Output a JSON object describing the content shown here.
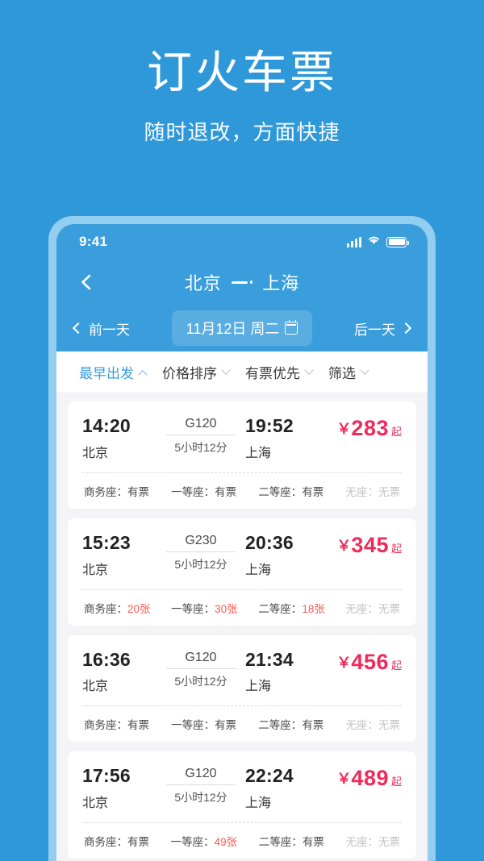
{
  "promo": {
    "title": "订火车票",
    "subtitle": "随时退改，方面快捷"
  },
  "colors": {
    "background_blue": "#2e98d8",
    "phone_frame": "#93cdef",
    "header_blue": "#3a9edc",
    "price_pink": "#ef2b5c",
    "count_red": "#fa5a52",
    "list_background": "#f4f4f6"
  },
  "status_bar": {
    "time": "9:41",
    "icons": [
      "signal-icon",
      "wifi-icon",
      "battery-icon"
    ]
  },
  "nav_header": {
    "back_icon": "chevron-left-icon",
    "origin": "北京",
    "destination": "上海",
    "arrow_icon": "one-way-arrow-icon"
  },
  "date_bar": {
    "prev_label": "前一天",
    "prev_icon": "chevron-left-icon",
    "date_label": "11月12日 周二",
    "calendar_icon": "calendar-icon",
    "next_label": "后一天",
    "next_icon": "chevron-right-icon"
  },
  "filter_bar": {
    "items": [
      {
        "label": "最早出发",
        "icon": "chevron-up-icon",
        "active": true
      },
      {
        "label": "价格排序",
        "icon": "chevron-down-icon",
        "active": false
      },
      {
        "label": "有票优先",
        "icon": "chevron-down-icon",
        "active": false
      },
      {
        "label": "筛选",
        "icon": "chevron-down-icon",
        "active": false
      }
    ]
  },
  "train_list": {
    "currency_symbol": "￥",
    "price_suffix": "起",
    "trains": [
      {
        "depart_time": "14:20",
        "depart_station": "北京",
        "train_no": "G120",
        "duration": "5小时12分",
        "arrive_time": "19:52",
        "arrive_station": "上海",
        "price": "283",
        "seats": [
          {
            "label": "商务座：",
            "value": "有票",
            "type": "text"
          },
          {
            "label": "一等座：",
            "value": "有票",
            "type": "text"
          },
          {
            "label": "二等座：",
            "value": "有票",
            "type": "text"
          },
          {
            "label": "无座：",
            "value": "无票",
            "type": "none"
          }
        ]
      },
      {
        "depart_time": "15:23",
        "depart_station": "北京",
        "train_no": "G230",
        "duration": "5小时12分",
        "arrive_time": "20:36",
        "arrive_station": "上海",
        "price": "345",
        "seats": [
          {
            "label": "商务座：",
            "value": "20张",
            "type": "count"
          },
          {
            "label": "一等座：",
            "value": "30张",
            "type": "count"
          },
          {
            "label": "二等座：",
            "value": "18张",
            "type": "count"
          },
          {
            "label": "无座：",
            "value": "无票",
            "type": "none"
          }
        ]
      },
      {
        "depart_time": "16:36",
        "depart_station": "北京",
        "train_no": "G120",
        "duration": "5小时12分",
        "arrive_time": "21:34",
        "arrive_station": "上海",
        "price": "456",
        "seats": [
          {
            "label": "商务座：",
            "value": "有票",
            "type": "text"
          },
          {
            "label": "一等座：",
            "value": "有票",
            "type": "text"
          },
          {
            "label": "二等座：",
            "value": "有票",
            "type": "text"
          },
          {
            "label": "无座：",
            "value": "无票",
            "type": "none"
          }
        ]
      },
      {
        "depart_time": "17:56",
        "depart_station": "北京",
        "train_no": "G120",
        "duration": "5小时12分",
        "arrive_time": "22:24",
        "arrive_station": "上海",
        "price": "489",
        "seats": [
          {
            "label": "商务座：",
            "value": "有票",
            "type": "text"
          },
          {
            "label": "一等座：",
            "value": "49张",
            "type": "count"
          },
          {
            "label": "二等座：",
            "value": "有票",
            "type": "text"
          },
          {
            "label": "无座：",
            "value": "无票",
            "type": "none"
          }
        ]
      }
    ]
  }
}
